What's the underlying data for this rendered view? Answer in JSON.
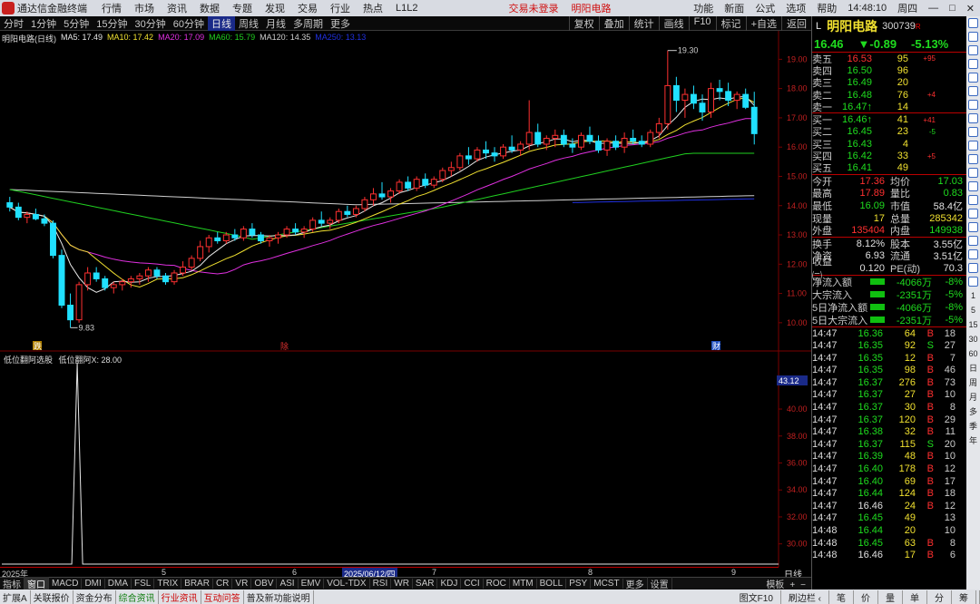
{
  "app": {
    "title": "通达信金融终端",
    "warning": "交易未登录",
    "stock_tag": "明阳电路",
    "time": "14:48:10",
    "weekday": "周四"
  },
  "menu": [
    "行情",
    "市场",
    "资讯",
    "数据",
    "专题",
    "发现",
    "交易",
    "行业",
    "热点",
    "L1L2"
  ],
  "menu_right": [
    "功能",
    "新面",
    "公式",
    "选项",
    "帮助"
  ],
  "periods": [
    "分时",
    "1分钟",
    "5分钟",
    "15分钟",
    "30分钟",
    "60分钟",
    "日线",
    "周线",
    "月线",
    "多周期",
    "更多"
  ],
  "period_active": "日线",
  "toolbar_right": [
    "复权",
    "叠加",
    "统计",
    "画线",
    "F10",
    "标记",
    "+自选",
    "返回"
  ],
  "legend": {
    "title": "明阳电路(日线)",
    "ma": [
      {
        "label": "MA5: 17.49",
        "color": "#e8e8e8"
      },
      {
        "label": "MA10: 17.42",
        "color": "#f0e030"
      },
      {
        "label": "MA20: 17.09",
        "color": "#e030e0"
      },
      {
        "label": "MA60: 15.79",
        "color": "#20d020"
      },
      {
        "label": "MA120: 14.35",
        "color": "#d0d0d0"
      },
      {
        "label": "MA250: 13.13",
        "color": "#2030e0"
      }
    ]
  },
  "chart_data": {
    "type": "candlestick",
    "ylim": [
      9.5,
      19.6
    ],
    "yticks": [
      10,
      11,
      12,
      13,
      14,
      15,
      16,
      17,
      18,
      19
    ],
    "annotations": {
      "high": "19.30",
      "low": "9.83",
      "marker_down": "跌",
      "marker_cut": "除",
      "marker_fin": "财"
    },
    "candles": [
      [
        14.1,
        14.3,
        13.8,
        13.95
      ],
      [
        13.95,
        14.1,
        13.5,
        13.6
      ],
      [
        13.6,
        13.8,
        13.4,
        13.7
      ],
      [
        13.7,
        13.9,
        13.5,
        13.55
      ],
      [
        13.55,
        13.7,
        13.3,
        13.4
      ],
      [
        13.4,
        13.5,
        12.2,
        12.3
      ],
      [
        12.3,
        12.5,
        10.5,
        10.6
      ],
      [
        10.6,
        11.0,
        9.83,
        10.1
      ],
      [
        10.1,
        11.4,
        10.0,
        11.3
      ],
      [
        11.3,
        11.9,
        11.1,
        11.7
      ],
      [
        11.7,
        11.9,
        11.4,
        11.5
      ],
      [
        11.5,
        11.6,
        11.1,
        11.2
      ],
      [
        11.2,
        11.4,
        11.0,
        11.3
      ],
      [
        11.3,
        11.5,
        11.1,
        11.4
      ],
      [
        11.4,
        11.6,
        11.2,
        11.5
      ],
      [
        11.5,
        11.7,
        11.3,
        11.6
      ],
      [
        11.6,
        11.9,
        11.4,
        11.8
      ],
      [
        11.8,
        11.9,
        11.5,
        11.6
      ],
      [
        11.6,
        11.7,
        11.3,
        11.4
      ],
      [
        11.4,
        11.8,
        11.3,
        11.7
      ],
      [
        11.7,
        12.1,
        11.6,
        11.9
      ],
      [
        11.9,
        12.3,
        11.8,
        12.2
      ],
      [
        12.2,
        12.8,
        12.1,
        12.6
      ],
      [
        12.6,
        13.0,
        12.4,
        12.9
      ],
      [
        12.9,
        13.1,
        12.7,
        12.8
      ],
      [
        12.8,
        13.1,
        12.7,
        13.0
      ],
      [
        13.0,
        13.2,
        12.8,
        12.9
      ],
      [
        12.9,
        13.3,
        12.8,
        13.2
      ],
      [
        13.2,
        13.4,
        12.9,
        13.0
      ],
      [
        13.0,
        13.1,
        12.7,
        12.8
      ],
      [
        12.8,
        13.0,
        12.6,
        12.9
      ],
      [
        12.9,
        13.1,
        12.7,
        13.0
      ],
      [
        13.0,
        13.3,
        12.9,
        13.2
      ],
      [
        13.2,
        13.4,
        13.0,
        13.1
      ],
      [
        13.1,
        13.3,
        12.9,
        13.2
      ],
      [
        13.2,
        13.6,
        13.1,
        13.5
      ],
      [
        13.5,
        13.8,
        13.3,
        13.4
      ],
      [
        13.4,
        13.6,
        13.2,
        13.5
      ],
      [
        13.5,
        13.9,
        13.4,
        13.8
      ],
      [
        13.8,
        14.0,
        13.6,
        13.7
      ],
      [
        13.7,
        14.0,
        13.6,
        13.9
      ],
      [
        13.9,
        14.3,
        13.8,
        14.2
      ],
      [
        14.2,
        14.6,
        14.0,
        14.4
      ],
      [
        14.4,
        14.8,
        14.2,
        14.3
      ],
      [
        14.3,
        14.6,
        14.1,
        14.5
      ],
      [
        14.5,
        14.9,
        14.4,
        14.8
      ],
      [
        14.8,
        15.0,
        14.5,
        14.6
      ],
      [
        14.6,
        15.0,
        14.5,
        14.9
      ],
      [
        14.9,
        15.1,
        14.6,
        14.7
      ],
      [
        14.7,
        15.0,
        14.6,
        14.9
      ],
      [
        14.9,
        15.3,
        14.8,
        15.2
      ],
      [
        15.2,
        15.5,
        15.0,
        15.3
      ],
      [
        15.3,
        15.8,
        15.2,
        15.7
      ],
      [
        15.7,
        16.0,
        15.4,
        15.6
      ],
      [
        15.6,
        16.0,
        15.5,
        15.9
      ],
      [
        15.9,
        16.2,
        15.6,
        15.8
      ],
      [
        15.8,
        16.0,
        15.5,
        15.7
      ],
      [
        15.7,
        16.1,
        15.6,
        16.0
      ],
      [
        16.0,
        16.4,
        15.8,
        15.9
      ],
      [
        15.9,
        16.2,
        15.7,
        16.1
      ],
      [
        16.1,
        17.6,
        15.9,
        16.5
      ],
      [
        16.5,
        16.8,
        16.0,
        16.1
      ],
      [
        16.1,
        16.4,
        15.9,
        16.3
      ],
      [
        16.3,
        16.6,
        16.0,
        16.4
      ],
      [
        16.4,
        16.6,
        16.0,
        16.1
      ],
      [
        16.1,
        16.3,
        15.8,
        16.0
      ],
      [
        16.0,
        16.5,
        15.9,
        16.4
      ],
      [
        16.4,
        16.7,
        16.1,
        16.2
      ],
      [
        16.2,
        16.4,
        15.8,
        15.9
      ],
      [
        15.9,
        16.3,
        15.7,
        16.2
      ],
      [
        16.2,
        16.4,
        15.9,
        16.0
      ],
      [
        16.0,
        16.5,
        15.8,
        16.3
      ],
      [
        16.3,
        16.6,
        16.1,
        16.2
      ],
      [
        16.2,
        16.4,
        16.0,
        16.1
      ],
      [
        16.1,
        16.6,
        16.0,
        16.5
      ],
      [
        16.5,
        17.0,
        16.3,
        16.8
      ],
      [
        16.8,
        19.3,
        16.6,
        18.1
      ],
      [
        18.1,
        18.4,
        17.2,
        17.6
      ],
      [
        17.6,
        18.0,
        17.0,
        17.8
      ],
      [
        17.8,
        18.1,
        17.3,
        17.5
      ],
      [
        17.5,
        17.8,
        16.9,
        17.2
      ],
      [
        17.2,
        18.2,
        17.0,
        18.0
      ],
      [
        18.0,
        18.3,
        17.6,
        17.9
      ],
      [
        17.9,
        18.2,
        17.4,
        17.6
      ],
      [
        17.6,
        17.9,
        17.3,
        17.8
      ],
      [
        17.8,
        18.0,
        17.3,
        17.36
      ],
      [
        17.36,
        17.89,
        16.09,
        16.46
      ]
    ]
  },
  "indicator": {
    "name": "低位翻阿选股",
    "label": "低位翻阿X: 28.00",
    "yticks": [
      30,
      32,
      34,
      36,
      38,
      40,
      42
    ],
    "ylim": [
      28.5,
      43.5
    ],
    "current": "43.12",
    "peak_at": 8
  },
  "axis_labels": {
    "start": "2025年",
    "m5": "5",
    "m6": "6",
    "date": "2025/06/12/四",
    "m7": "7",
    "m8": "8",
    "m9": "9",
    "period": "日线"
  },
  "tabs": [
    "指标",
    "窗口",
    "MACD",
    "DMI",
    "DMA",
    "FSL",
    "TRIX",
    "BRAR",
    "CR",
    "VR",
    "OBV",
    "ASI",
    "EMV",
    "VOL-TDX",
    "RSI",
    "WR",
    "SAR",
    "KDJ",
    "CCI",
    "ROC",
    "MTM",
    "BOLL",
    "PSY",
    "MCST",
    "更多",
    "设置"
  ],
  "tabs_right": [
    "模板",
    "+",
    "−"
  ],
  "status": [
    "扩展A",
    "关联报价",
    "资金分布",
    "综合资讯",
    "行业资讯",
    "互动问答",
    "普及新功能说明"
  ],
  "status_right": [
    "图文F10",
    "刷边栏 ‹",
    "笔",
    "价",
    "量",
    "单",
    "分",
    "筹"
  ],
  "quote": {
    "name": "明阳电路",
    "code": "300739",
    "mark": "R",
    "L": "L",
    "price": "16.46",
    "change": "▼-0.89",
    "pct": "-5.13%",
    "asks": [
      {
        "l": "卖五",
        "p": "16.53",
        "v": "95",
        "d": "+95",
        "c": "r"
      },
      {
        "l": "卖四",
        "p": "16.50",
        "v": "96",
        "d": "",
        "c": "g"
      },
      {
        "l": "卖三",
        "p": "16.49",
        "v": "20",
        "d": "",
        "c": "g"
      },
      {
        "l": "卖二",
        "p": "16.48",
        "v": "76",
        "d": "+4",
        "c": "g"
      },
      {
        "l": "卖一",
        "p": "16.47↑",
        "v": "14",
        "d": "",
        "c": "g"
      }
    ],
    "bids": [
      {
        "l": "买一",
        "p": "16.46↑",
        "v": "41",
        "d": "+41",
        "c": "g"
      },
      {
        "l": "买二",
        "p": "16.45",
        "v": "23",
        "d": "-5",
        "c": "g"
      },
      {
        "l": "买三",
        "p": "16.43",
        "v": "4",
        "d": "",
        "c": "g"
      },
      {
        "l": "买四",
        "p": "16.42",
        "v": "33",
        "d": "+5",
        "c": "g"
      },
      {
        "l": "买五",
        "p": "16.41",
        "v": "49",
        "d": "",
        "c": "g"
      }
    ],
    "stats": [
      {
        "k": "今开",
        "v": "17.36",
        "vc": "r",
        "k2": "均价",
        "v2": "17.03",
        "v2c": "g"
      },
      {
        "k": "最高",
        "v": "17.89",
        "vc": "r",
        "k2": "量比",
        "v2": "0.83",
        "v2c": "g"
      },
      {
        "k": "最低",
        "v": "16.09",
        "vc": "g",
        "k2": "市值",
        "v2": "58.4亿",
        "v2c": "w"
      },
      {
        "k": "现量",
        "v": "17",
        "vc": "y",
        "k2": "总量",
        "v2": "285342",
        "v2c": "y"
      },
      {
        "k": "外盘",
        "v": "135404",
        "vc": "r",
        "k2": "内盘",
        "v2": "149938",
        "v2c": "g"
      }
    ],
    "stats2": [
      {
        "k": "换手",
        "v": "8.12%",
        "vc": "w",
        "k2": "股本",
        "v2": "3.55亿",
        "v2c": "w"
      },
      {
        "k": "净资",
        "v": "6.93",
        "vc": "w",
        "k2": "流通",
        "v2": "3.51亿",
        "v2c": "w"
      },
      {
        "k": "收益㈡",
        "v": "0.120",
        "vc": "w",
        "k2": "PE(动)",
        "v2": "70.3",
        "v2c": "w"
      }
    ],
    "flows": [
      {
        "k": "净流入额",
        "v": "-4066万",
        "p": "-8%"
      },
      {
        "k": "大宗流入",
        "v": "-2351万",
        "p": "-5%"
      },
      {
        "k": "5日净流入额",
        "v": "-4066万",
        "p": "-8%"
      },
      {
        "k": "5日大宗流入",
        "v": "-2351万",
        "p": "-5%"
      }
    ],
    "ticks": [
      {
        "t": "14:47",
        "p": "16.36",
        "v": "64",
        "s": "B",
        "n": "18"
      },
      {
        "t": "14:47",
        "p": "16.35",
        "v": "92",
        "s": "S",
        "n": "27"
      },
      {
        "t": "14:47",
        "p": "16.35",
        "v": "12",
        "s": "B",
        "n": "7"
      },
      {
        "t": "14:47",
        "p": "16.35",
        "v": "98",
        "s": "B",
        "n": "46"
      },
      {
        "t": "14:47",
        "p": "16.37",
        "v": "276",
        "s": "B",
        "n": "73"
      },
      {
        "t": "14:47",
        "p": "16.37",
        "v": "27",
        "s": "B",
        "n": "10"
      },
      {
        "t": "14:47",
        "p": "16.37",
        "v": "30",
        "s": "B",
        "n": "8"
      },
      {
        "t": "14:47",
        "p": "16.37",
        "v": "120",
        "s": "B",
        "n": "29"
      },
      {
        "t": "14:47",
        "p": "16.38",
        "v": "32",
        "s": "B",
        "n": "11"
      },
      {
        "t": "14:47",
        "p": "16.37",
        "v": "115",
        "s": "S",
        "n": "20"
      },
      {
        "t": "14:47",
        "p": "16.39",
        "v": "48",
        "s": "B",
        "n": "10"
      },
      {
        "t": "14:47",
        "p": "16.40",
        "v": "178",
        "s": "B",
        "n": "12"
      },
      {
        "t": "14:47",
        "p": "16.40",
        "v": "69",
        "s": "B",
        "n": "17"
      },
      {
        "t": "14:47",
        "p": "16.44",
        "v": "124",
        "s": "B",
        "n": "18"
      },
      {
        "t": "14:47",
        "p": "16.46",
        "v": "24",
        "s": "B",
        "n": "12"
      },
      {
        "t": "14:47",
        "p": "16.45",
        "v": "49",
        "s": "",
        "n": "13"
      },
      {
        "t": "14:48",
        "p": "16.44",
        "v": "20",
        "s": "",
        "n": "10"
      },
      {
        "t": "14:48",
        "p": "16.45",
        "v": "63",
        "s": "B",
        "n": "8"
      },
      {
        "t": "14:48",
        "p": "16.46",
        "v": "17",
        "s": "B",
        "n": "6"
      }
    ]
  },
  "sidebar_labels": [
    "1",
    "5",
    "15",
    "30",
    "60",
    "日",
    "周",
    "月",
    "多",
    "季",
    "年"
  ],
  "colors": {
    "up": "#ff3030",
    "down": "#20e0ff",
    "grid": "#7a0000"
  }
}
